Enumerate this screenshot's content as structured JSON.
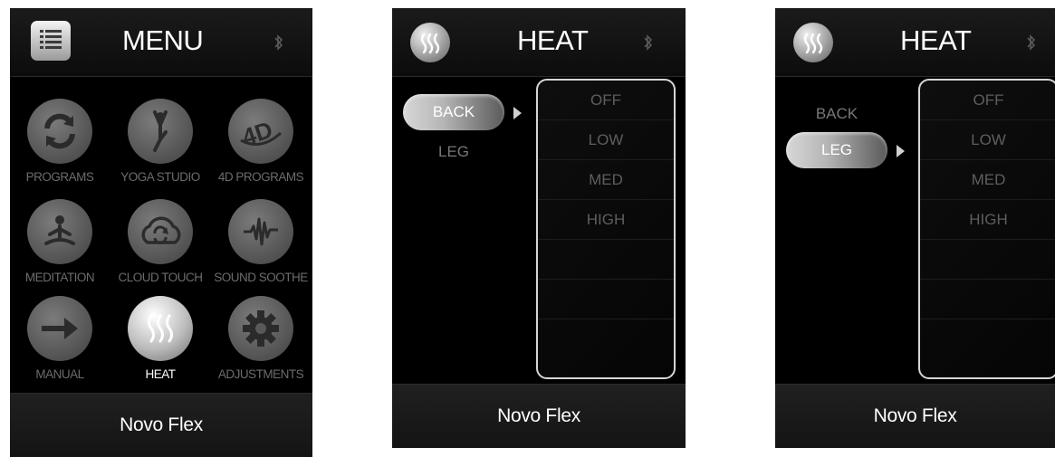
{
  "menu_screen": {
    "title": "MENU",
    "bluetooth_icon": "bluetooth-icon",
    "menu_icon": "list-menu-icon",
    "items": [
      {
        "label": "PROGRAMS",
        "icon": "programs-refresh-icon",
        "active": false
      },
      {
        "label": "YOGA STUDIO",
        "icon": "yoga-figure-icon",
        "active": false
      },
      {
        "label": "4D PROGRAMS",
        "icon": "4d-icon",
        "active": false
      },
      {
        "label": "MEDITATION",
        "icon": "meditation-figure-icon",
        "active": false
      },
      {
        "label": "CLOUD TOUCH",
        "icon": "cloud-touch-icon",
        "active": false
      },
      {
        "label": "SOUND SOOTHE",
        "icon": "sound-wave-icon",
        "active": false
      },
      {
        "label": "MANUAL",
        "icon": "arrow-right-icon",
        "active": false
      },
      {
        "label": "HEAT",
        "icon": "heat-waves-icon",
        "active": true
      },
      {
        "label": "ADJUSTMENTS",
        "icon": "gear-icon",
        "active": false
      }
    ],
    "footer": "Novo Flex"
  },
  "heat_screen_back": {
    "title": "HEAT",
    "zones": [
      {
        "label": "BACK",
        "selected": true
      },
      {
        "label": "LEG",
        "selected": false
      }
    ],
    "levels": [
      "OFF",
      "LOW",
      "MED",
      "HIGH",
      "",
      "",
      ""
    ],
    "footer": "Novo Flex"
  },
  "heat_screen_leg": {
    "title": "HEAT",
    "zones": [
      {
        "label": "BACK",
        "selected": false
      },
      {
        "label": "LEG",
        "selected": true
      }
    ],
    "levels": [
      "OFF",
      "LOW",
      "MED",
      "HIGH",
      "",
      "",
      ""
    ],
    "footer": "Novo Flex"
  },
  "colors": {
    "screen_bg": "#000000",
    "inactive_icon": "#5a5a5a",
    "inactive_text": "#6c6c6c",
    "active_text": "#ffffff",
    "level_text": "#5e5e5e"
  }
}
